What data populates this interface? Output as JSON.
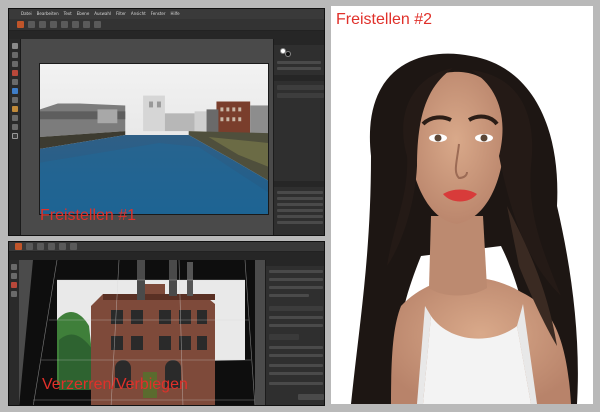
{
  "captions": {
    "freistellen_1": "Freistellen #1",
    "freistellen_2": "Freistellen #2",
    "verzerren": "Verzerren/Verbiegen"
  },
  "app_window_1": {
    "menu": [
      "Datei",
      "Bearbeiten",
      "Text",
      "Ebene",
      "Auswahl",
      "Filter",
      "Ansicht",
      "Fenster",
      "Hilfe"
    ],
    "tools": [
      "move-tool",
      "select-tool",
      "crop-tool",
      "brush-tool",
      "eraser-tool",
      "fill-tool",
      "text-tool",
      "shape-tool",
      "zoom-tool",
      "hand-tool",
      "color-picker-tool"
    ],
    "accent_color": "#c0552a"
  },
  "colors": {
    "caption": "#e0302a",
    "background": "#b9b9b9",
    "ui_dark": "#2d2d2d"
  }
}
